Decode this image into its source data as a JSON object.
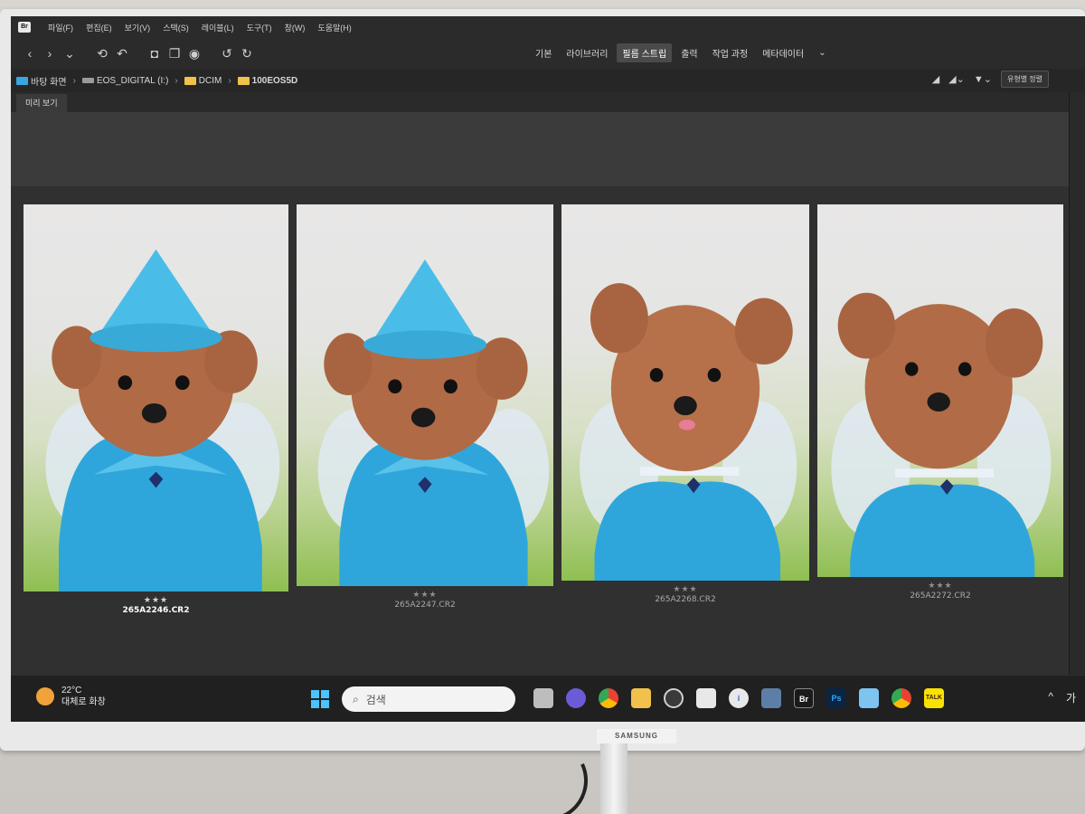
{
  "monitor": {
    "brand": "SAMSUNG"
  },
  "menubar": {
    "logo": "Br",
    "items": [
      "파일(F)",
      "편집(E)",
      "보기(V)",
      "스택(S)",
      "레이블(L)",
      "도구(T)",
      "창(W)",
      "도움말(H)"
    ]
  },
  "toolbar": {
    "workspaces": [
      "기본",
      "라이브러리",
      "필름 스트립",
      "출력",
      "작업 과정",
      "메타데이터"
    ],
    "active_workspace": "필름 스트립"
  },
  "path": {
    "segments": [
      "바탕 화면",
      "EOS_DIGITAL (I:)",
      "DCIM",
      "100EOS5D"
    ],
    "sort_button": "유형별 정렬"
  },
  "panel": {
    "tab": "미리 보기"
  },
  "thumbnails": [
    {
      "filename": "265A2246.CR2",
      "stars": "★★★",
      "variant": "hat"
    },
    {
      "filename": "265A2247.CR2",
      "stars": "★★★",
      "variant": "hat"
    },
    {
      "filename": "265A2268.CR2",
      "stars": "★★★",
      "variant": "nohat"
    },
    {
      "filename": "265A2272.CR2",
      "stars": "★★★",
      "variant": "nohat"
    }
  ],
  "taskbar": {
    "weather_temp": "22°C",
    "weather_desc": "대체로 화창",
    "search_placeholder": "검색",
    "tray_caret": "^",
    "tray_ime": "가"
  },
  "colors": {
    "filename_selected": "#ffffff",
    "filename": "#a9a9a9",
    "accent_blue": "#4cc2ff",
    "dress_blue": "#2fa6db"
  }
}
